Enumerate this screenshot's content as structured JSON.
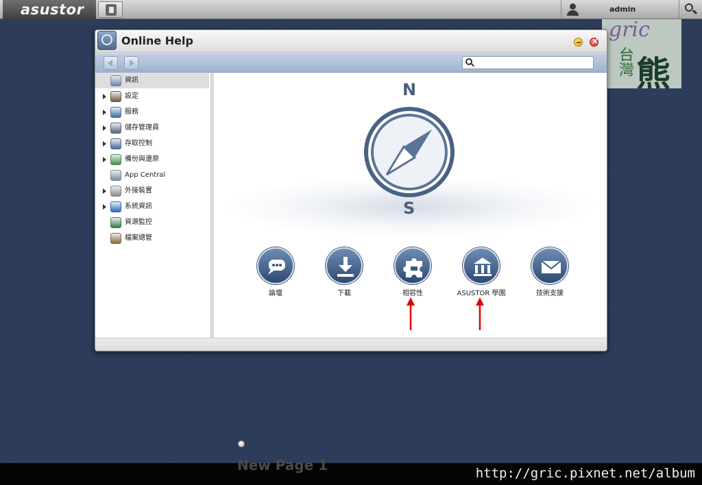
{
  "topbar": {
    "logo_text": "asustor",
    "user_name": "admin",
    "search_icon": "search-icon",
    "app_icon": "online-help-icon"
  },
  "window": {
    "title": "Online Help",
    "search_placeholder": "",
    "minimize_icon": "minimize-icon",
    "close_icon": "close-icon"
  },
  "sidebar": {
    "items": [
      {
        "label": "資訊",
        "has_arrow": false,
        "selected": true,
        "icon": "compass-icon",
        "color": "#6a86ad"
      },
      {
        "label": "設定",
        "has_arrow": true,
        "selected": false,
        "icon": "settings-icon",
        "color": "#6d5a3e"
      },
      {
        "label": "服務",
        "has_arrow": true,
        "selected": false,
        "icon": "services-icon",
        "color": "#3f6fa6"
      },
      {
        "label": "儲存管理員",
        "has_arrow": true,
        "selected": false,
        "icon": "storage-icon",
        "color": "#5a6577"
      },
      {
        "label": "存取控制",
        "has_arrow": true,
        "selected": false,
        "icon": "access-control-icon",
        "color": "#4a6a9a"
      },
      {
        "label": "備份與還原",
        "has_arrow": true,
        "selected": false,
        "icon": "backup-icon",
        "color": "#4a8a4a"
      },
      {
        "label": "App Central",
        "has_arrow": false,
        "selected": false,
        "icon": "app-central-icon",
        "color": "#7a8a9a"
      },
      {
        "label": "外接裝置",
        "has_arrow": true,
        "selected": false,
        "icon": "external-device-icon",
        "color": "#8a8a8a"
      },
      {
        "label": "系統資訊",
        "has_arrow": true,
        "selected": false,
        "icon": "system-info-icon",
        "color": "#2f6ab8"
      },
      {
        "label": "資源監控",
        "has_arrow": false,
        "selected": false,
        "icon": "resource-monitor-icon",
        "color": "#3a7a4a"
      },
      {
        "label": "檔案總管",
        "has_arrow": false,
        "selected": false,
        "icon": "file-explorer-icon",
        "color": "#8a6a3a"
      }
    ]
  },
  "main": {
    "compass_n": "N",
    "compass_s": "S",
    "features": [
      {
        "label": "論壇",
        "icon": "forum-icon"
      },
      {
        "label": "下載",
        "icon": "download-icon"
      },
      {
        "label": "相容性",
        "icon": "compatibility-icon"
      },
      {
        "label": "ASUSTOR 學園",
        "icon": "academy-icon"
      },
      {
        "label": "技術支援",
        "icon": "support-icon"
      }
    ]
  },
  "watermark": {
    "gric": "gric",
    "cn_small": "台灣",
    "cn_big": "熊",
    "url": "http://gric.pixnet.net/album"
  },
  "desktop": {
    "page_label": "New Page 1"
  }
}
